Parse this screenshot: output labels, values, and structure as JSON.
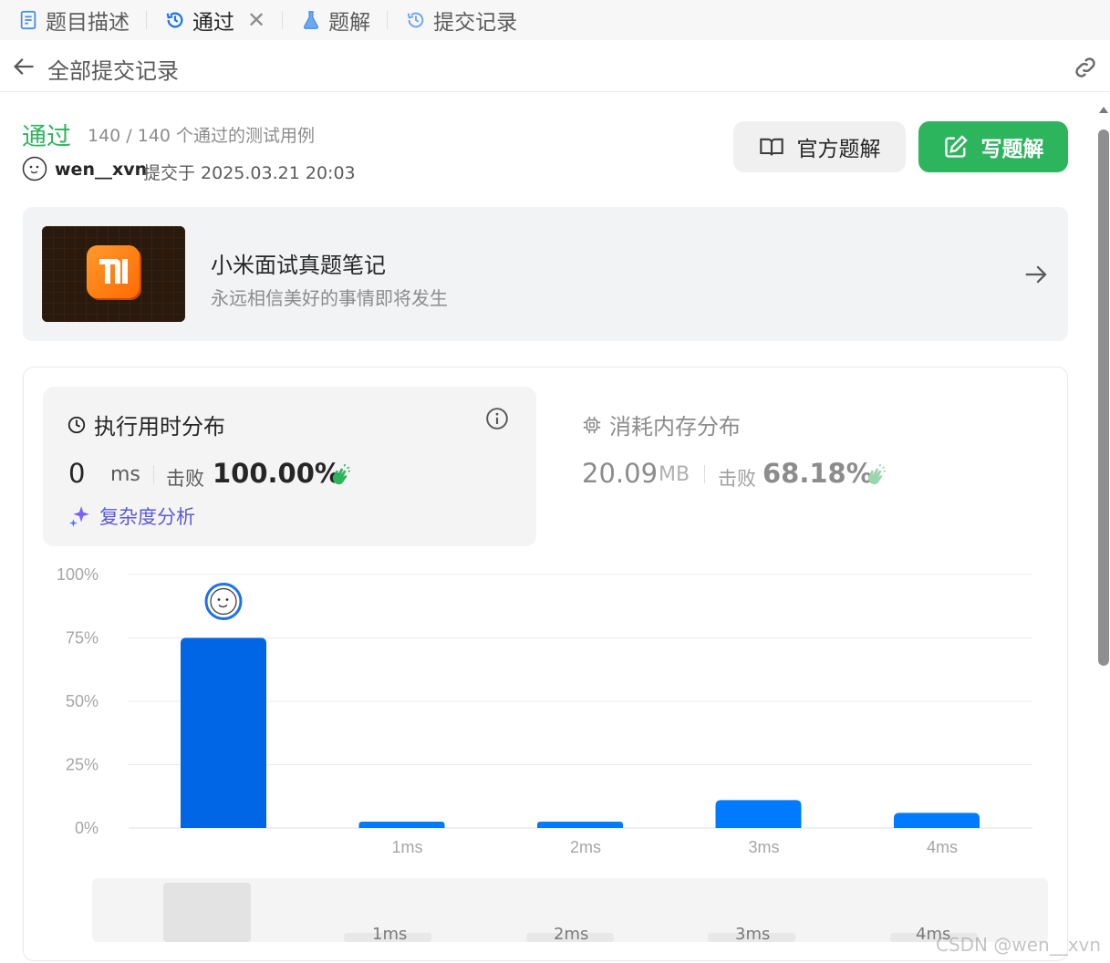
{
  "tabs": [
    {
      "label": "题目描述",
      "icon": "document-icon"
    },
    {
      "label": "通过",
      "icon": "history-icon",
      "active": true,
      "closable": true
    },
    {
      "label": "题解",
      "icon": "flask-icon"
    },
    {
      "label": "提交记录",
      "icon": "history-icon"
    }
  ],
  "header": {
    "back_label": "全部提交记录"
  },
  "submission": {
    "status": "通过",
    "cases": "140 / 140 个通过的测试用例",
    "user": "wen__xvn",
    "submitted": "提交于 2025.03.21 20:03"
  },
  "buttons": {
    "official": "官方题解",
    "write": "写题解"
  },
  "promo": {
    "title": "小米面试真题笔记",
    "subtitle": "永远相信美好的事情即将发生",
    "logo_text": "mi"
  },
  "runtime": {
    "title": "执行用时分布",
    "value": "0",
    "unit": "ms",
    "beat_label": "击败",
    "beat_value": "100.00%",
    "complexity": "复杂度分析"
  },
  "memory": {
    "title": "消耗内存分布",
    "value": "20.09",
    "unit": "MB",
    "beat_label": "击败",
    "beat_value": "68.18%"
  },
  "colors": {
    "accent_green": "#2db55d",
    "bar_blue": "#007aff",
    "bar_selected": "#0066e6",
    "purple": "#5b5bd6"
  },
  "chart_data": {
    "type": "bar",
    "categories": [
      "",
      "1ms",
      "2ms",
      "3ms",
      "4ms"
    ],
    "values": [
      75,
      2.5,
      2.5,
      11,
      6
    ],
    "ylim": [
      0,
      100
    ],
    "yticks": [
      "100%",
      "75%",
      "50%",
      "25%",
      "0%"
    ],
    "highlight_index": 0,
    "grid": true
  },
  "mini_labels": [
    "1ms",
    "2ms",
    "3ms",
    "4ms"
  ],
  "watermark": "CSDN @wen__xvn"
}
